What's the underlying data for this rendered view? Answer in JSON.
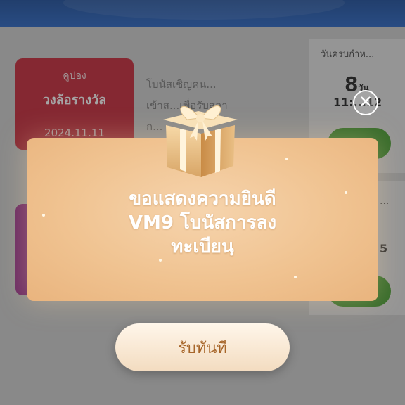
{
  "background": {
    "coupon": {
      "type_label": "คูปอง",
      "name": "วงล้อรางวัล",
      "date": "2024.11.11"
    },
    "description_lines": [
      "โบนัสเชิญคน...",
      "เข้าส...เพื่อรับสลา",
      "ก..."
    ],
    "deadline_label": "วันครบกำห...",
    "days_value": "8",
    "days_unit": "วัน",
    "time_value": "11:...12",
    "second_card_dots": "...",
    "second_card_number": "5"
  },
  "modal": {
    "message_line1": "ขอแสดงความยินดี",
    "message_line2": "VM9 โบนัสการลง",
    "message_line3": "ทะเบียนฺ",
    "close_symbol": "✕",
    "claim_label": "รับทันที",
    "gift_icon": "gift-box-icon"
  },
  "colors": {
    "header_blue": "#2a66c4",
    "coupon_red": "#c8293a",
    "modal_peach": "#f0c391",
    "claim_text": "#a7662a",
    "green_button": "#3f9a2a"
  }
}
